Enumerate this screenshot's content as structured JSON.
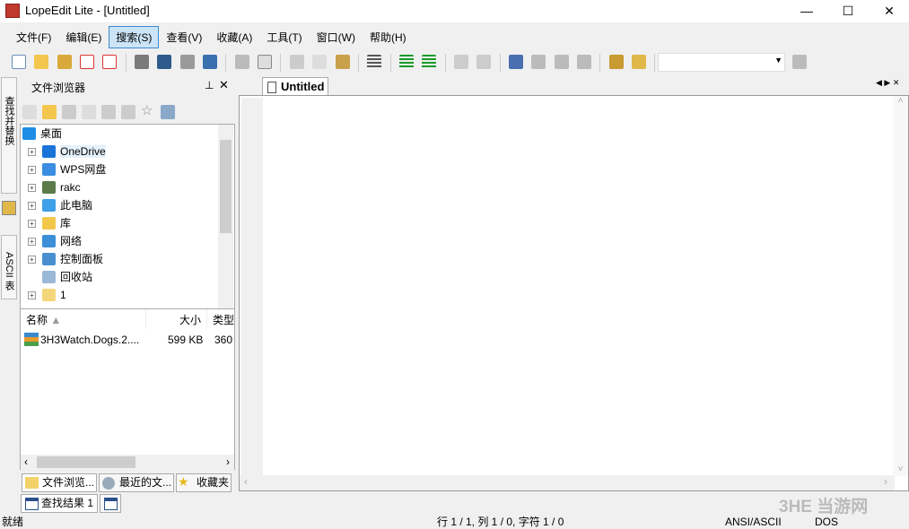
{
  "window": {
    "title": "LopeEdit Lite - [Untitled]",
    "controls": [
      "—",
      "☐",
      "✕"
    ]
  },
  "menu": [
    "文件(F)",
    "编辑(E)",
    "搜索(S)",
    "查看(V)",
    "收藏(A)",
    "工具(T)",
    "窗口(W)",
    "帮助(H)"
  ],
  "menu_active": "搜索(S)",
  "side_tabs": [
    "查找并替换",
    "ASCII 表"
  ],
  "file_browser": {
    "title": "文件浏览器",
    "tree": [
      {
        "label": "桌面",
        "expand": false,
        "icon": "desktop",
        "color": "#1e8ee6"
      },
      {
        "label": "OneDrive",
        "expand": true,
        "icon": "cloud",
        "color": "#1a73d9"
      },
      {
        "label": "WPS网盘",
        "expand": true,
        "icon": "cloud-outline",
        "color": "#3a8de0"
      },
      {
        "label": "rakc",
        "expand": true,
        "icon": "user",
        "color": "#5a7a4a"
      },
      {
        "label": "此电脑",
        "expand": true,
        "icon": "computer",
        "color": "#3ea0e8"
      },
      {
        "label": "库",
        "expand": true,
        "icon": "library",
        "color": "#f2c84b"
      },
      {
        "label": "网络",
        "expand": true,
        "icon": "network",
        "color": "#3b8fd8"
      },
      {
        "label": "控制面板",
        "expand": true,
        "icon": "control-panel",
        "color": "#4a90d0"
      },
      {
        "label": "回收站",
        "expand": false,
        "icon": "recycle-bin",
        "color": "#9bb8d8"
      },
      {
        "label": "1",
        "expand": true,
        "icon": "folder",
        "color": "#f5d67a"
      }
    ],
    "columns": [
      "名称",
      "大小",
      "类型"
    ],
    "files": [
      {
        "name": "3H3Watch.Dogs.2....",
        "size": "599 KB",
        "type": "360"
      }
    ],
    "bottom_tabs": [
      "文件浏览...",
      "最近的文...",
      "收藏夹"
    ]
  },
  "results_tabs": [
    "查找结果 1",
    ""
  ],
  "editor": {
    "tab": "Untitled"
  },
  "status": {
    "left": "就绪",
    "position": "行 1 / 1, 列 1 / 0, 字符 1 / 0",
    "encoding": "ANSI/ASCII",
    "line_ending": "DOS"
  },
  "watermark": "3HE 当游网"
}
